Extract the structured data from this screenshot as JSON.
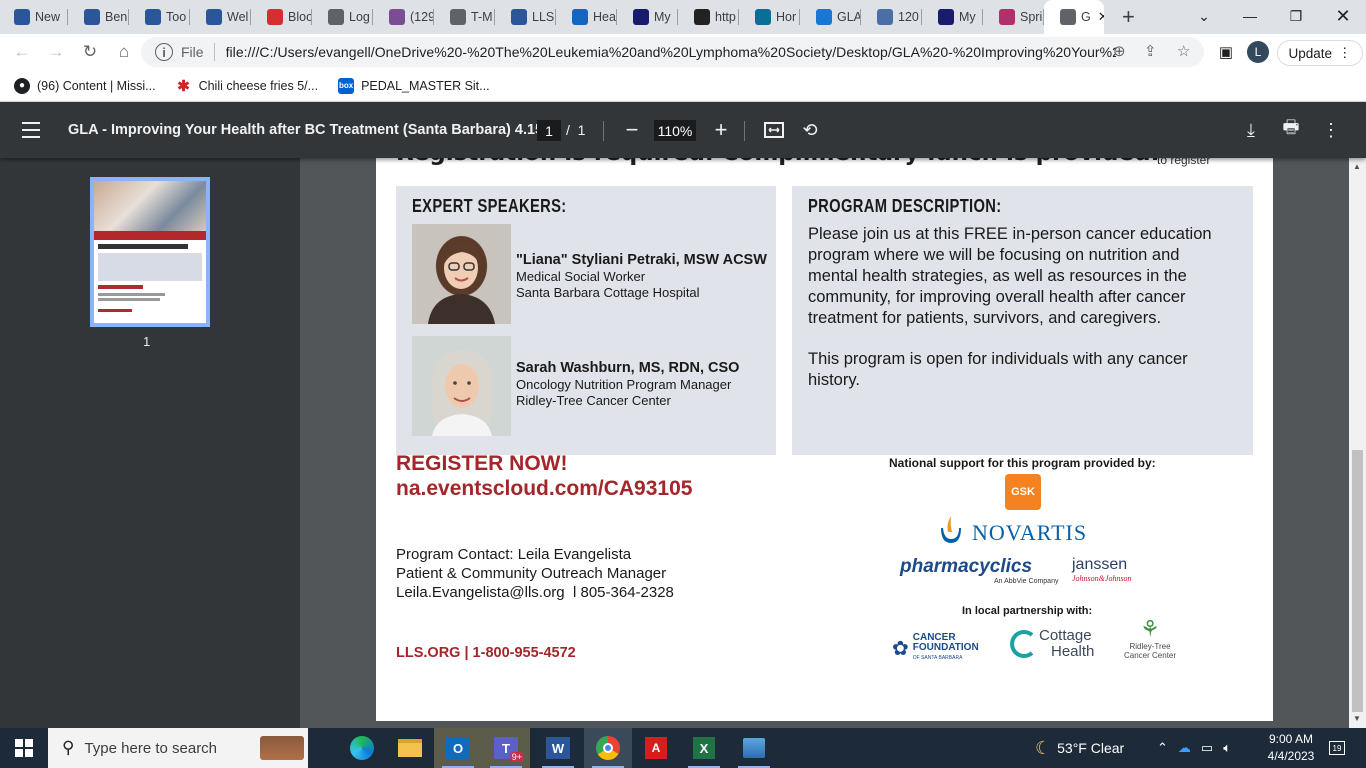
{
  "browser": {
    "tabs": [
      {
        "label": "New",
        "icon": "word-icon",
        "color": "#2b579a"
      },
      {
        "label": "Ben",
        "icon": "word-icon",
        "color": "#2b579a"
      },
      {
        "label": "Too",
        "icon": "word-icon",
        "color": "#2b579a"
      },
      {
        "label": "Wel",
        "icon": "word-icon",
        "color": "#2b579a"
      },
      {
        "label": "Bloo",
        "icon": "blood-drop-icon",
        "color": "#d32f2f"
      },
      {
        "label": "Log",
        "icon": "globe-icon",
        "color": "#5f6368"
      },
      {
        "label": "(129",
        "icon": "mail-icon",
        "color": "#7b4b94"
      },
      {
        "label": "T-M",
        "icon": "globe-icon",
        "color": "#5f6368"
      },
      {
        "label": "LLS",
        "icon": "word-icon",
        "color": "#2b579a"
      },
      {
        "label": "Hea",
        "icon": "tree-icon",
        "color": "#1565c0"
      },
      {
        "label": "My",
        "icon": "circle-icon",
        "color": "#1a1a6e"
      },
      {
        "label": "http",
        "icon": "strava-icon",
        "color": "#222"
      },
      {
        "label": "Hor",
        "icon": "c-icon",
        "color": "#0b6e99"
      },
      {
        "label": "GLA",
        "icon": "c-icon",
        "color": "#1976d2"
      },
      {
        "label": "120",
        "icon": "t-icon",
        "color": "#4a6fa5"
      },
      {
        "label": "My",
        "icon": "circle-icon",
        "color": "#1a1a6e"
      },
      {
        "label": "Spri",
        "icon": "sprout-icon",
        "color": "#b0306a"
      },
      {
        "label": "G",
        "icon": "globe-icon",
        "color": "#5f6368"
      }
    ],
    "url_label": "File",
    "url": "file:///C:/Users/evangell/OneDrive%20-%20The%20Leukemia%20and%20Lymphoma%20Society/Desktop/GLA%20-%20Improving%20Your%2...",
    "profile_initial": "L",
    "update_label": "Update",
    "bookmarks": [
      {
        "label": "(96) Content | Missi...",
        "icon": "site-icon"
      },
      {
        "label": "Chili cheese fries 5/...",
        "icon": "yelp-icon"
      },
      {
        "label": "PEDAL_MASTER Sit...",
        "icon": "box-icon"
      }
    ]
  },
  "pdf": {
    "title": "GLA - Improving Your Health after BC Treatment (Santa Barbara) 4.15....",
    "page_current": "1",
    "page_separator": "/",
    "page_total": "1",
    "zoom": "110%",
    "thumb_label": "1"
  },
  "flyer": {
    "top_banner": "Registration is required. Complimentary lunch is provided.",
    "to_register": "to register",
    "speakers_heading": "EXPERT SPEAKERS:",
    "speakers": [
      {
        "name": "\"Liana\" Styliani Petraki, MSW ACSW",
        "role": "Medical Social Worker",
        "org": "Santa Barbara Cottage Hospital"
      },
      {
        "name": "Sarah Washburn, MS, RDN, CSO",
        "role": "Oncology Nutrition Program Manager",
        "org": "Ridley-Tree Cancer Center"
      }
    ],
    "description_heading": "PROGRAM DESCRIPTION:",
    "description_p1": "Please join us at this FREE in-person cancer education program where we will be focusing on nutrition and mental health strategies, as well as resources in the community, for improving overall health after cancer treatment for patients, survivors, and caregivers.",
    "description_p2": "This program is open for individuals with any cancer history.",
    "register_now": "REGISTER NOW!",
    "register_url": "na.eventscloud.com/CA93105",
    "contact_line1": "Program Contact: Leila Evangelista",
    "contact_line2": "Patient & Community Outreach Manager",
    "contact_line3": "Leila.Evangelista@lls.org  l 805-364-2328",
    "lls_line": "LLS.ORG | 1-800-955-4572",
    "support_heading": "National support for this program provided by:",
    "gsk": "GSK",
    "novartis": "NOVARTIS",
    "pharmacyclics": "pharmacyclics",
    "pharmacyclics_sub": "An AbbVie Company",
    "janssen": "janssen",
    "janssen_sub": "Johnson&Johnson",
    "local_heading": "In local partnership with:",
    "cancer_foundation_1": "CANCER",
    "cancer_foundation_2": "FOUNDATION",
    "cancer_foundation_3": "OF SANTA BARBARA",
    "cottage_1": "Cottage",
    "cottage_2": "Health",
    "ridley_1": "Ridley-Tree",
    "ridley_2": "Cancer Center"
  },
  "taskbar": {
    "search_placeholder": "Type here to search",
    "weather": "53°F  Clear",
    "time": "9:00 AM",
    "date": "4/4/2023",
    "notification_count": "19",
    "teams_badge": "9+"
  },
  "colors": {
    "brand_red": "#a3262a",
    "pdf_toolbar": "#323639",
    "accent_blue": "#8ab4f8"
  }
}
